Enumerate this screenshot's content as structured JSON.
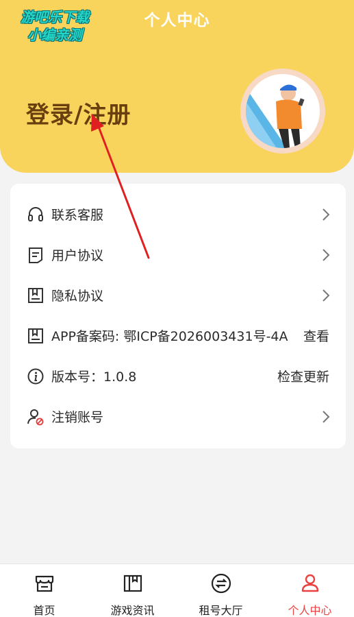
{
  "header": {
    "title": "个人中心",
    "watermark_line1": "游吧乐下载",
    "watermark_line2": "小编亲测",
    "login_label": "登录/注册"
  },
  "menu": {
    "items": [
      {
        "label": "联系客服",
        "icon": "headset-icon",
        "trailing": "chevron"
      },
      {
        "label": "用户协议",
        "icon": "document-icon",
        "trailing": "chevron"
      },
      {
        "label": "隐私协议",
        "icon": "bookmark-document-icon",
        "trailing": "chevron"
      },
      {
        "label": "APP备案码: 鄂ICP备2026003431号-4A",
        "icon": "bookmark-document-icon",
        "trailing": "text",
        "action": "查看"
      },
      {
        "label": "版本号：1.0.8",
        "icon": "info-icon",
        "trailing": "text",
        "action": "检查更新"
      },
      {
        "label": "注销账号",
        "icon": "user-cancel-icon",
        "trailing": "chevron"
      }
    ]
  },
  "tabbar": {
    "tabs": [
      {
        "label": "首页",
        "icon": "store-icon",
        "active": false
      },
      {
        "label": "游戏资讯",
        "icon": "news-book-icon",
        "active": false
      },
      {
        "label": "租号大厅",
        "icon": "exchange-icon",
        "active": false
      },
      {
        "label": "个人中心",
        "icon": "person-icon",
        "active": true
      }
    ]
  },
  "colors": {
    "header_bg": "#f8d45c",
    "login_text": "#6a3f0f",
    "active_tab": "#ec4141",
    "annotation_arrow": "#e02020"
  }
}
